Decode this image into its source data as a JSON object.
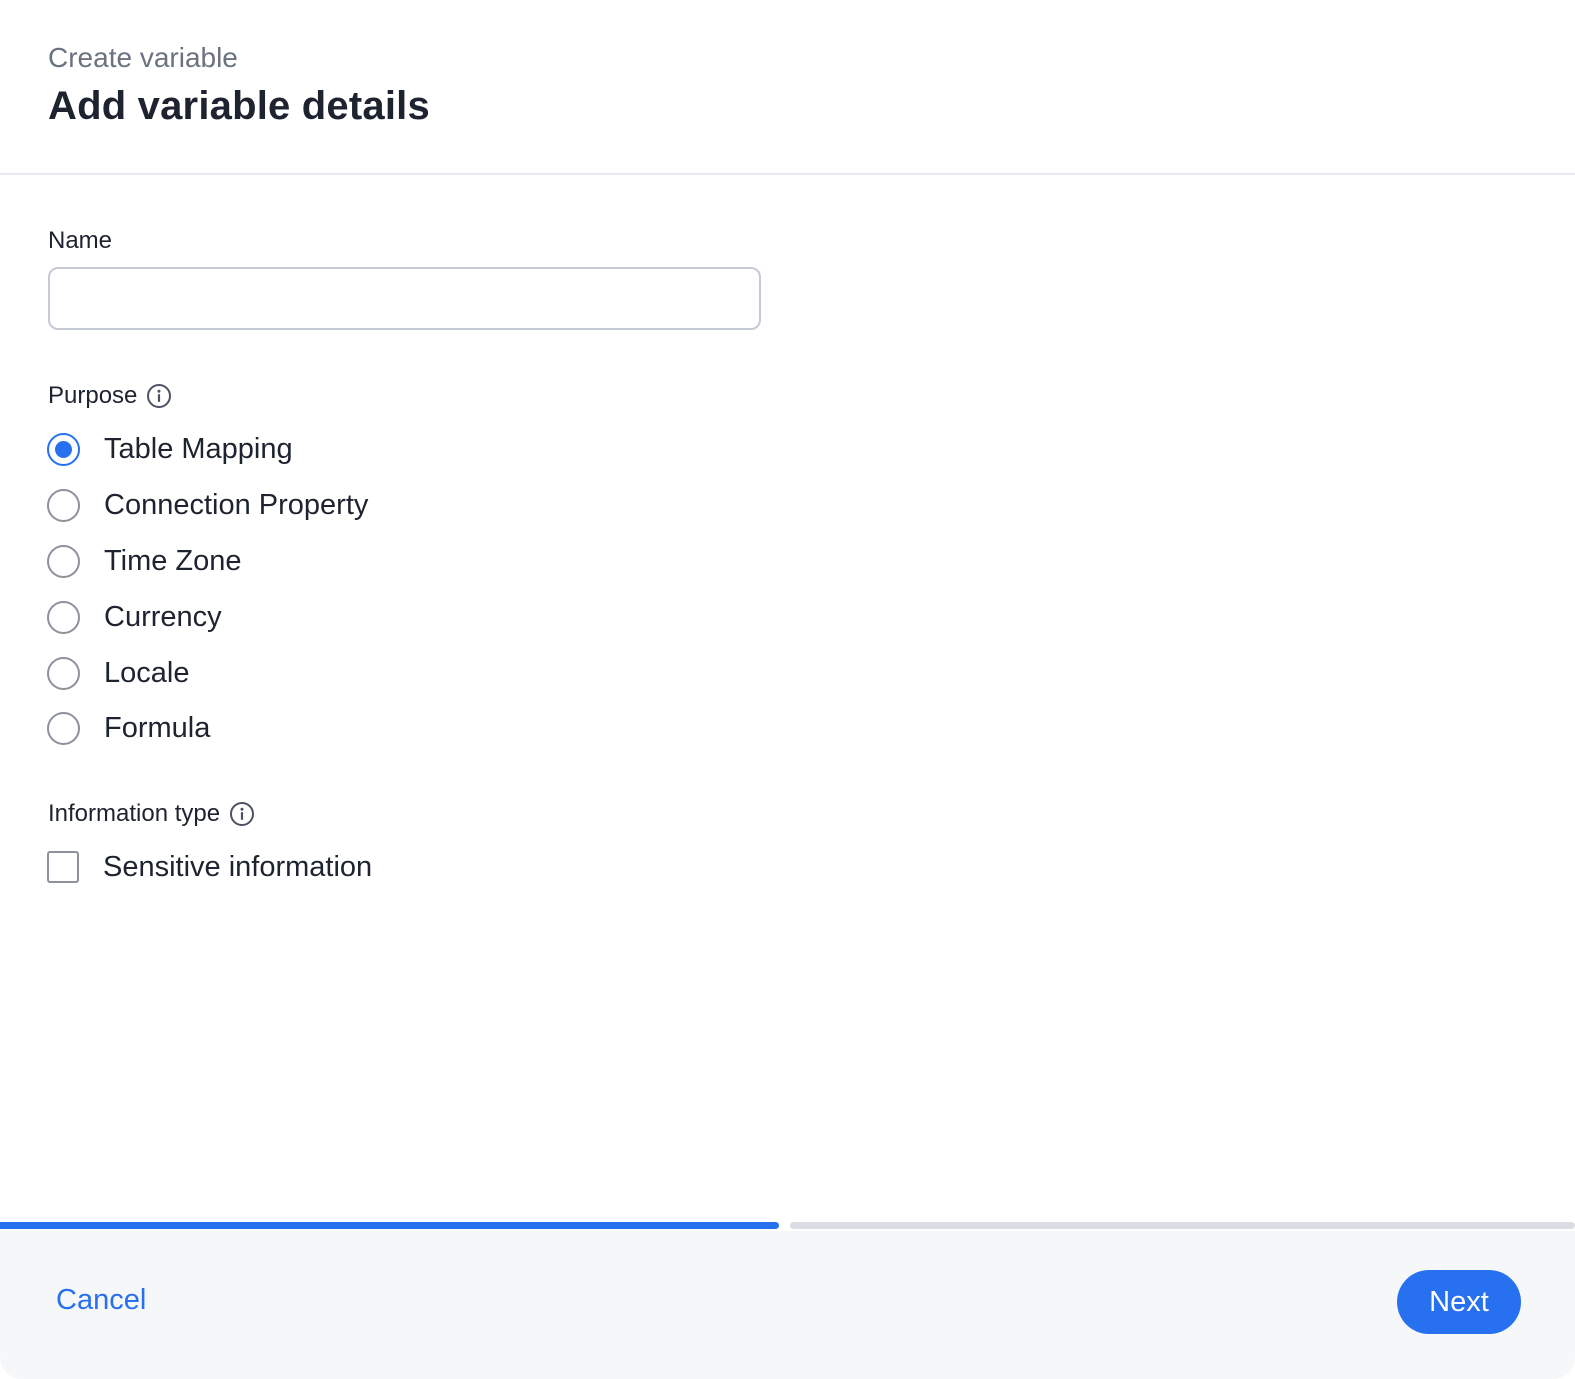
{
  "header": {
    "subtitle": "Create variable",
    "title": "Add variable details"
  },
  "name_field": {
    "label": "Name",
    "value": "",
    "placeholder": ""
  },
  "purpose": {
    "label": "Purpose",
    "options": [
      {
        "label": "Table Mapping",
        "selected": true
      },
      {
        "label": "Connection Property",
        "selected": false
      },
      {
        "label": "Time Zone",
        "selected": false
      },
      {
        "label": "Currency",
        "selected": false
      },
      {
        "label": "Locale",
        "selected": false
      },
      {
        "label": "Formula",
        "selected": false
      }
    ]
  },
  "information_type": {
    "label": "Information type",
    "checkbox_label": "Sensitive information",
    "checked": false
  },
  "progress": {
    "completed_fraction": 0.5
  },
  "footer": {
    "cancel_label": "Cancel",
    "next_label": "Next"
  },
  "colors": {
    "accent": "#2770ef",
    "footer_bg": "#f6f7f9",
    "text": "#1d232f",
    "muted": "#6b7280"
  },
  "icons": {
    "info": "info-circle-icon"
  }
}
